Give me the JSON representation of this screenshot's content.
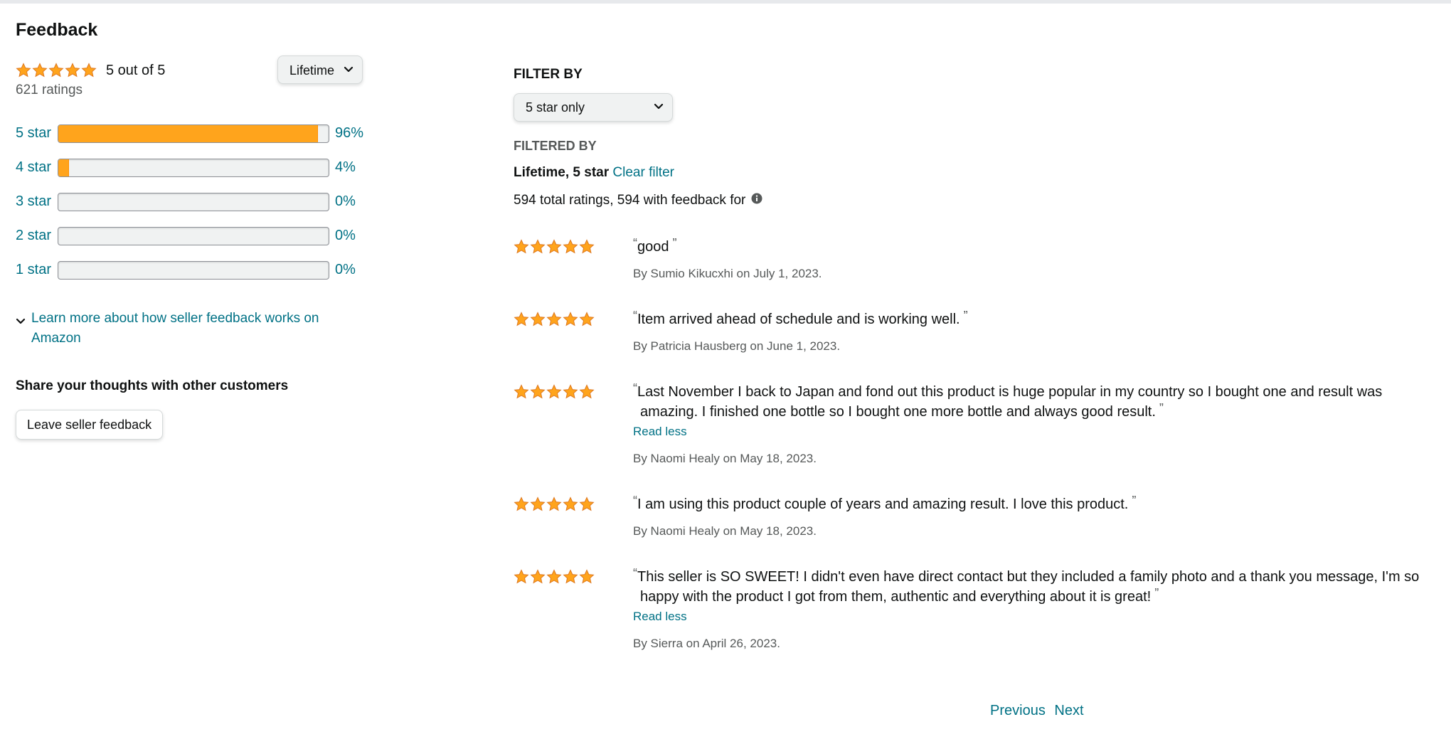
{
  "title": "Feedback",
  "summary": {
    "rating_text": "5 out of  5",
    "ratings_count": "621 ratings",
    "stars": 5,
    "lifetime_label": "Lifetime"
  },
  "histogram": [
    {
      "label": "5 star",
      "percent_text": "96%",
      "percent": 96
    },
    {
      "label": "4 star",
      "percent_text": "4%",
      "percent": 4
    },
    {
      "label": "3 star",
      "percent_text": "0%",
      "percent": 0
    },
    {
      "label": "2 star",
      "percent_text": "0%",
      "percent": 0
    },
    {
      "label": "1 star",
      "percent_text": "0%",
      "percent": 0
    }
  ],
  "learn_more": "Learn more about how seller feedback works on Amazon",
  "share": {
    "heading": "Share your thoughts with other customers",
    "button": "Leave seller feedback"
  },
  "filter": {
    "filter_by_label": "FILTER BY",
    "selected": "5 star only",
    "filtered_by_label": "FILTERED BY",
    "active_filters": "Lifetime, 5 star",
    "clear_filter": "Clear filter",
    "totals": "594 total ratings, 594 with feedback for"
  },
  "reviews": [
    {
      "stars": 5,
      "text": "good",
      "read_less": "",
      "byline": "By Sumio Kikucxhi on July 1, 2023."
    },
    {
      "stars": 5,
      "text": "Item arrived ahead of schedule and is working well.",
      "read_less": "",
      "byline": "By Patricia Hausberg on June 1, 2023."
    },
    {
      "stars": 5,
      "text": "Last November I back to Japan and fond out this product is huge popular in my country so I bought one and result was amazing. I finished one bottle so I bought one more bottle and always good result.",
      "read_less": "Read less",
      "byline": "By Naomi Healy on May 18, 2023."
    },
    {
      "stars": 5,
      "text": "I am using this product couple of years and amazing result. I love this product.",
      "read_less": "",
      "byline": "By Naomi Healy on May 18, 2023."
    },
    {
      "stars": 5,
      "text": "This seller is SO SWEET! I didn't even have direct contact but they included a family photo and a thank you message, I'm so happy with the product I got from them, authentic and everything about it is great!",
      "read_less": "Read less",
      "byline": "By Sierra on April 26, 2023."
    }
  ],
  "pager": {
    "previous": "Previous",
    "next": "Next"
  },
  "colors": {
    "star": "#ffa41c",
    "link": "#007185"
  }
}
